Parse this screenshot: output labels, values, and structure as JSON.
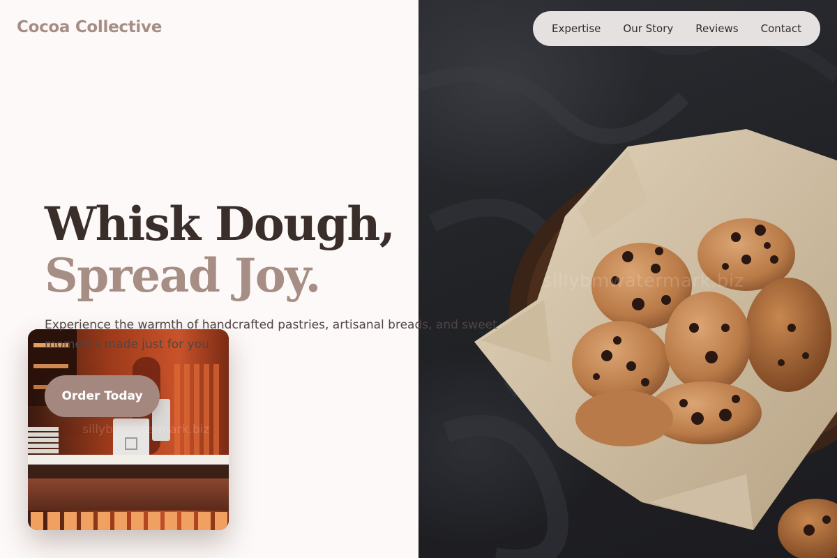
{
  "brand": {
    "name": "Cocoa Collective"
  },
  "nav": {
    "items": [
      {
        "label": "Expertise"
      },
      {
        "label": "Our Story"
      },
      {
        "label": "Reviews"
      },
      {
        "label": "Contact"
      }
    ]
  },
  "hero": {
    "title_line1": "Whisk Dough,",
    "title_line2": "Spread Joy.",
    "subtitle": "Experience the warmth of handcrafted pastries, artisanal breads, and sweet moments made just for you.",
    "cta_label": "Order Today"
  },
  "images": {
    "hero_photo": "cookies-in-basket-photo",
    "cafe_photo": "cafe-counter-photo",
    "watermark": "sillybmwatermark.biz"
  },
  "colors": {
    "brand": "#a68e85",
    "title_dark": "#3a2e2b",
    "accent": "#a4887f",
    "background": "#fdf9f8",
    "nav_bg": "#e4e1e0"
  }
}
